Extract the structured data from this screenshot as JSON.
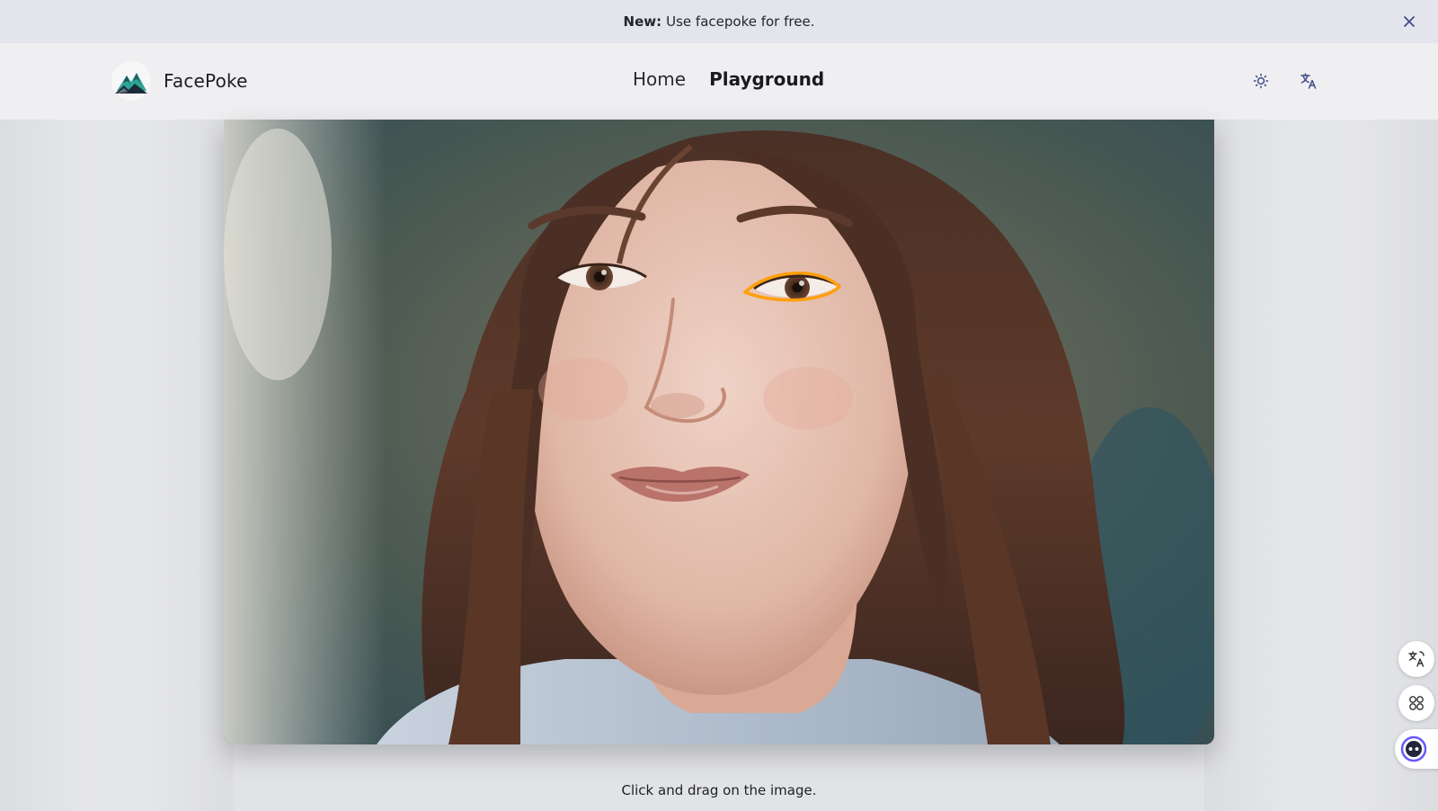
{
  "announcement": {
    "badge": "New:",
    "text": "Use facepoke for free."
  },
  "header": {
    "brand": "FacePoke",
    "nav": [
      {
        "label": "Home",
        "active": false
      },
      {
        "label": "Playground",
        "active": true
      }
    ],
    "icons": [
      "sun-icon",
      "translate-icon"
    ]
  },
  "canvas": {
    "hint": "Click and drag on the image."
  },
  "side_buttons": [
    "translate-icon",
    "command-icon",
    "assistant-icon"
  ],
  "colors": {
    "accent": "#3f4a8a",
    "highlight": "#ff9f0a",
    "logo_teal": "#2ea596",
    "logo_dark": "#1c2b3a"
  }
}
